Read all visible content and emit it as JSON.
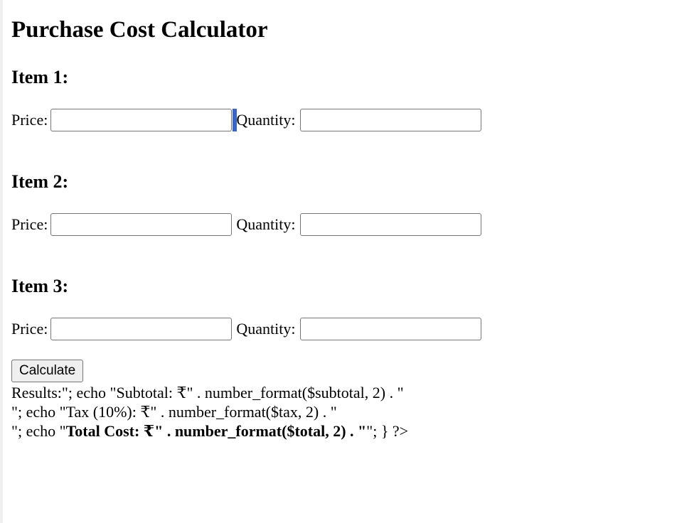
{
  "page": {
    "title": "Purchase Cost Calculator"
  },
  "items": [
    {
      "heading": "Item 1:",
      "price_label": "Price:",
      "price_value": "",
      "quantity_label": "Quantity:",
      "quantity_value": ""
    },
    {
      "heading": "Item 2:",
      "price_label": "Price:",
      "price_value": "",
      "quantity_label": "Quantity:",
      "quantity_value": ""
    },
    {
      "heading": "Item 3:",
      "price_label": "Price:",
      "price_value": "",
      "quantity_label": "Quantity:",
      "quantity_value": ""
    }
  ],
  "form": {
    "calculate_label": "Calculate"
  },
  "results": {
    "line1": "Results:\"; echo \"Subtotal: ₹\" . number_format($subtotal, 2) . \"",
    "line2": "\"; echo \"Tax (10%): ₹\" . number_format($tax, 2) . \"",
    "line3_prefix": "\"; echo \"",
    "line3_bold": "Total Cost: ₹\" . number_format($total, 2) . \"",
    "line3_suffix": "\"; } ?>"
  }
}
